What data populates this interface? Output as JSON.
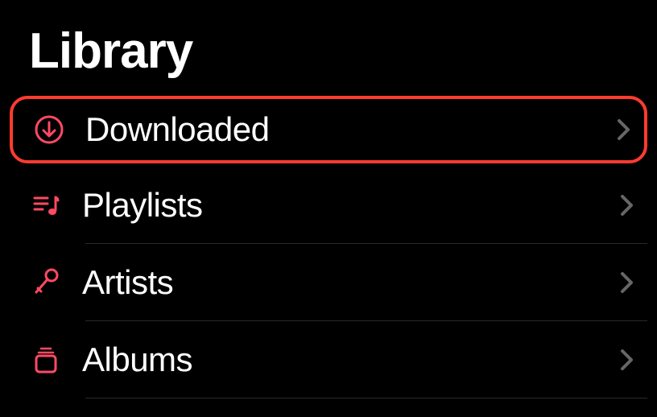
{
  "header": {
    "title": "Library"
  },
  "rows": [
    {
      "label": "Downloaded",
      "icon": "download-circle-icon",
      "highlighted": true
    },
    {
      "label": "Playlists",
      "icon": "playlist-icon",
      "highlighted": false
    },
    {
      "label": "Artists",
      "icon": "microphone-icon",
      "highlighted": false
    },
    {
      "label": "Albums",
      "icon": "albums-icon",
      "highlighted": false
    }
  ],
  "colors": {
    "accent": "#ff4a63",
    "highlightBorder": "#ff3b30"
  }
}
